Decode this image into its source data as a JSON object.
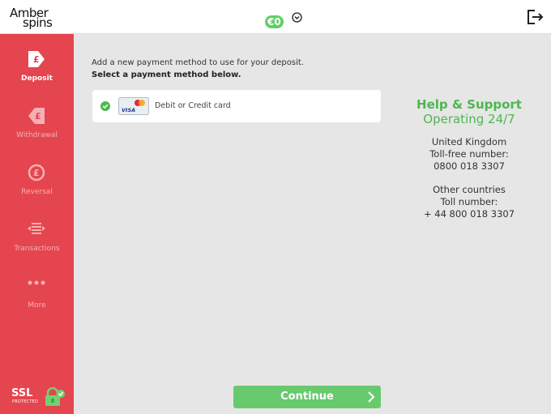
{
  "header": {
    "logo_line1": "Amber",
    "logo_line2": "spins",
    "balance": "€0",
    "logout_icon": "logout-icon",
    "dropdown_icon": "chevron-down-circle-icon"
  },
  "sidebar": {
    "items": [
      {
        "label": "Deposit",
        "icon": "deposit-icon",
        "active": true
      },
      {
        "label": "Withdrawal",
        "icon": "withdrawal-icon",
        "active": false
      },
      {
        "label": "Reversal",
        "icon": "reversal-icon",
        "active": false
      },
      {
        "label": "Transactions",
        "icon": "transactions-icon",
        "active": false
      },
      {
        "label": "More",
        "icon": "more-dots-icon",
        "active": false
      }
    ],
    "ssl": {
      "title": "SSL",
      "subtitle": "PROTECTED"
    }
  },
  "main": {
    "intro_line1": "Add a new payment method to use for your deposit.",
    "intro_line2": "Select a payment method below.",
    "payment_method": {
      "label": "Debit or Credit card",
      "card_text": "VISA"
    },
    "continue_label": "Continue"
  },
  "support": {
    "title": "Help & Support",
    "subtitle": "Operating 24/7",
    "uk_region": "United Kingdom",
    "uk_label": "Toll-free number:",
    "uk_number": "0800 018 3307",
    "other_region": "Other countries",
    "other_label": "Toll number:",
    "other_number": "+ 44 800 018 3307"
  },
  "colors": {
    "sidebar": "#e5454f",
    "accent_green": "#4cb84f",
    "button_green": "#67cb6d",
    "background": "#e6e6e6"
  }
}
